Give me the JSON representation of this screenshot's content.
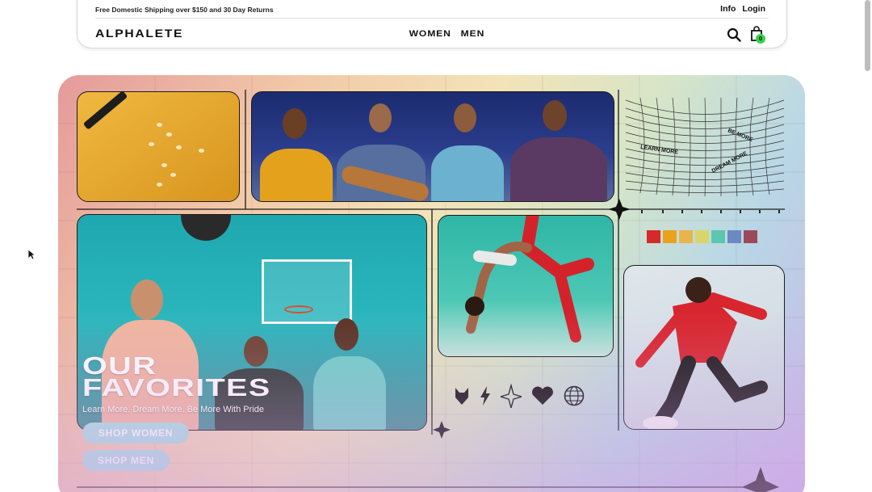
{
  "header": {
    "shipping_text": "Free Domestic Shipping over $150 and 30 Day Returns",
    "info_label": "Info",
    "login_label": "Login",
    "logo": "ALPHALETE",
    "nav": {
      "women": "WOMEN",
      "men": "MEN"
    },
    "cart_count": "0",
    "icons": {
      "search": "search-icon",
      "cart": "shopping-bag-icon"
    }
  },
  "hero": {
    "title_line1": "OUR",
    "title_line2": "FAVORITES",
    "subtitle": "Learn More. Dream More. Be More With Pride",
    "shop_women": "SHOP WOMEN",
    "shop_men": "SHOP MEN",
    "artwork_text": [
      "LEARN MORE",
      "BE MORE",
      "DREAM MORE"
    ],
    "swatch_colors": [
      "#d62a2a",
      "#e8a21c",
      "#e9b54a",
      "#d8d66a",
      "#5cc6b0",
      "#6d89c2",
      "#9c4a5b"
    ],
    "icon_row": [
      "wolf-head-icon",
      "lightning-bolt-icon",
      "sparkle-icon",
      "heart-icon",
      "globe-icon"
    ]
  },
  "colors": {
    "cart_badge": "#3ad14a",
    "button_bg": "#aae1e1"
  }
}
